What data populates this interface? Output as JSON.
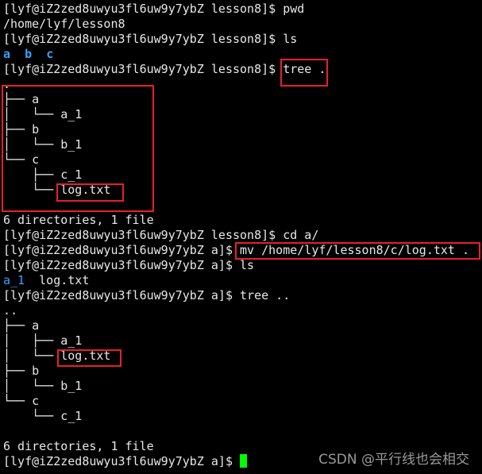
{
  "prompt_lesson8": "[lyf@iZ2zed8uwyu3fl6uw9y7ybZ lesson8]$ ",
  "prompt_a": "[lyf@iZ2zed8uwyu3fl6uw9y7ybZ a]$ ",
  "cmd_pwd": "pwd",
  "out_pwd": "/home/lyf/lesson8",
  "cmd_ls": "ls",
  "out_ls": [
    "a",
    "b",
    "c"
  ],
  "cmd_tree1": "tree .",
  "tree1": [
    ".",
    "├── a",
    "│   └── a_1",
    "├── b",
    "│   └── b_1",
    "└── c",
    "    ├── c_1",
    "    └── ",
    "log.txt",
    ""
  ],
  "summary": "6 directories, 1 file",
  "cmd_cd": "cd a/",
  "cmd_mv": "mv /home/lyf/lesson8/c/log.txt .",
  "cmd_ls2": "ls",
  "out_ls2_dir": "a_1",
  "out_ls2_file": "log.txt",
  "cmd_tree2": "tree ..",
  "tree2": [
    "..",
    "├── a",
    "│   ├── a_1",
    "│   └── ",
    "log.txt",
    "├── b",
    "│   └── b_1",
    "└── c",
    "    └── c_1",
    ""
  ],
  "watermark": "CSDN @平行线也会相交",
  "colors": {
    "highlight_box": "#e8202a",
    "directory": "#3aa0ff",
    "cursor": "#00ff00"
  }
}
